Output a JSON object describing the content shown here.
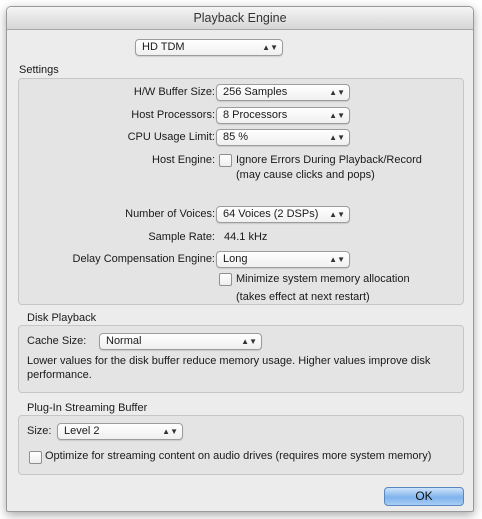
{
  "window": {
    "title": "Playback Engine"
  },
  "engine_select": {
    "value": "HD TDM"
  },
  "settings": {
    "title": "Settings",
    "hw_buffer": {
      "label": "H/W Buffer Size:",
      "value": "256 Samples"
    },
    "host_processors": {
      "label": "Host Processors:",
      "value": "8 Processors"
    },
    "cpu_usage": {
      "label": "CPU Usage Limit:",
      "value": "85 %"
    },
    "host_engine": {
      "label": "Host Engine:",
      "checkbox_label": "Ignore Errors During Playback/Record",
      "note": "(may cause clicks and pops)",
      "checked": false
    },
    "voices": {
      "label": "Number of Voices:",
      "value": "64 Voices (2 DSPs)"
    },
    "sample_rate": {
      "label": "Sample Rate:",
      "value": "44.1 kHz"
    },
    "delay_comp": {
      "label": "Delay Compensation Engine:",
      "value": "Long"
    },
    "minimize_memory": {
      "label": "Minimize system memory allocation",
      "note": "(takes effect at next restart)",
      "checked": false
    }
  },
  "disk_playback": {
    "title": "Disk Playback",
    "cache_label": "Cache Size:",
    "cache_value": "Normal",
    "description": "Lower values for the disk buffer reduce memory usage.  Higher values improve disk performance."
  },
  "plugin_streaming": {
    "title": "Plug-In Streaming Buffer",
    "size_label": "Size:",
    "size_value": "Level 2",
    "optimize_label": "Optimize for streaming content on audio drives (requires more system memory)",
    "optimize_checked": false
  },
  "buttons": {
    "ok": "OK"
  }
}
